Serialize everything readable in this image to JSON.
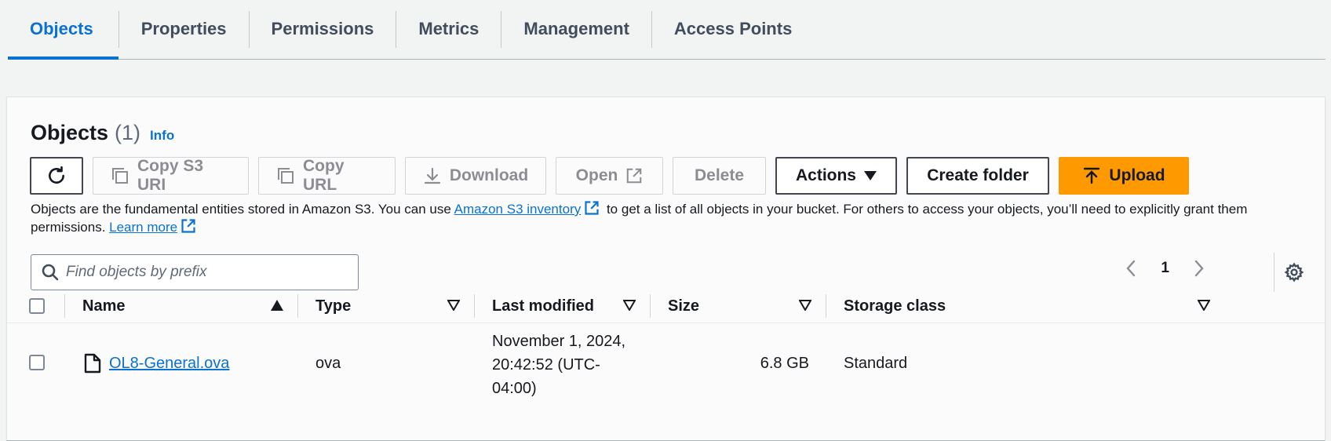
{
  "tabs": [
    {
      "label": "Objects",
      "active": true
    },
    {
      "label": "Properties"
    },
    {
      "label": "Permissions"
    },
    {
      "label": "Metrics"
    },
    {
      "label": "Management"
    },
    {
      "label": "Access Points"
    }
  ],
  "objects_header": {
    "title": "Objects",
    "count": "(1)",
    "info": "Info"
  },
  "toolbar": {
    "copy_s3_uri": "Copy S3 URI",
    "copy_url": "Copy URL",
    "download": "Download",
    "open": "Open",
    "delete": "Delete",
    "actions": "Actions",
    "create_folder": "Create folder",
    "upload": "Upload"
  },
  "description": {
    "part1": "Objects are the fundamental entities stored in Amazon S3. You can use ",
    "inventory_link": "Amazon S3 inventory",
    "part2": " to get a list of all objects in your bucket. For others to access your objects, you’ll need to explicitly grant them permissions. ",
    "learn_more": "Learn more"
  },
  "search": {
    "placeholder": "Find objects by prefix"
  },
  "pagination": {
    "current_page": "1"
  },
  "table": {
    "columns": [
      "Name",
      "Type",
      "Last modified",
      "Size",
      "Storage class"
    ],
    "rows": [
      {
        "name": "OL8-General.ova",
        "type": "ova",
        "last_modified_l1": "November 1, 2024,",
        "last_modified_l2": "20:42:52 (UTC-",
        "last_modified_l3": "04:00)",
        "size": "6.8 GB",
        "storage_class": "Standard"
      }
    ]
  },
  "colors": {
    "accent": "#0972d3",
    "upload": "#ff9900"
  }
}
